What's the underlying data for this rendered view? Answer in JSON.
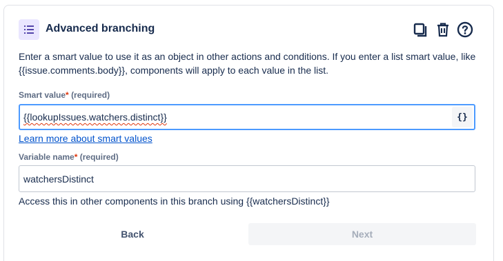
{
  "header": {
    "title": "Advanced branching",
    "icons": {
      "main": "list-icon",
      "copy": "copy-icon",
      "delete": "trash-icon",
      "help": "help-circle-icon"
    }
  },
  "description": "Enter a smart value to use it as an object in other actions and conditions. If you enter a list smart value, like {{issue.comments.body}}, components will apply to each value in the list.",
  "smart_value": {
    "label": "Smart value",
    "required_mark": "*",
    "required_hint": "(required)",
    "value": "{{lookupIssues.watchers.distinct}}",
    "button_label": "{}"
  },
  "learn_more_link": "Learn more about smart values",
  "variable_name": {
    "label": "Variable name",
    "required_mark": "*",
    "required_hint": "(required)",
    "value": "watchersDistinct",
    "helper": "Access this in other components in this branch using {{watchersDistinct}}"
  },
  "footer": {
    "back_label": "Back",
    "next_label": "Next"
  },
  "colors": {
    "accent": "#4c9aff",
    "link": "#0052cc",
    "required": "#de350b",
    "icon_bg": "#eae6ff",
    "icon_fg": "#5243aa"
  }
}
